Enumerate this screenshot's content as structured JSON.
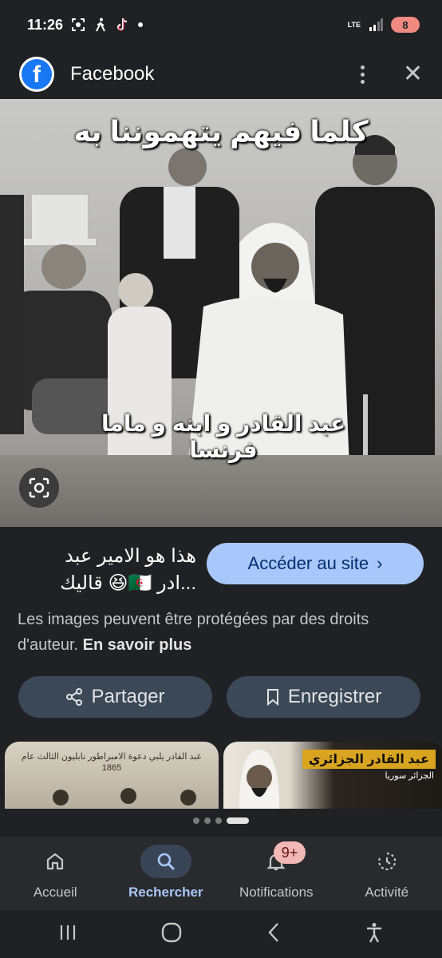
{
  "status_bar": {
    "time": "11:26",
    "network": "LTE",
    "battery": "8"
  },
  "app_bar": {
    "title": "Facebook",
    "logo_letter": "f"
  },
  "image": {
    "caption_top": "كلما فيهم يتهموننا به",
    "caption_bottom": "عبد القادر و ابنه و ماما فرنسا"
  },
  "info": {
    "description": "هذا هو الامير عبد ...ادر 🇩🇿😆 قاليك",
    "visit_button": "Accéder au site",
    "copyright_text": "Les images peuvent être protégées par des droits d'auteur.",
    "learn_more": "En savoir plus",
    "share_button": "Partager",
    "save_button": "Enregistrer"
  },
  "related": [
    {
      "text": "عبد القادر يلبي دعوة الامبراطور نابليون الثالث عام 1865"
    },
    {
      "title": "عبد القادر الجزائري",
      "subtitle": "الجزائر سوريا"
    }
  ],
  "bottom_nav": [
    {
      "label": "Accueil",
      "icon": "home-icon"
    },
    {
      "label": "Rechercher",
      "icon": "search-icon"
    },
    {
      "label": "Notifications",
      "icon": "bell-icon",
      "badge": "9+"
    },
    {
      "label": "Activité",
      "icon": "activity-icon"
    }
  ],
  "colors": {
    "background": "#202124",
    "accent": "#a8c7fa",
    "pill": "#3b4858",
    "badge": "#f2b8b5",
    "battery": "#f08a80"
  }
}
